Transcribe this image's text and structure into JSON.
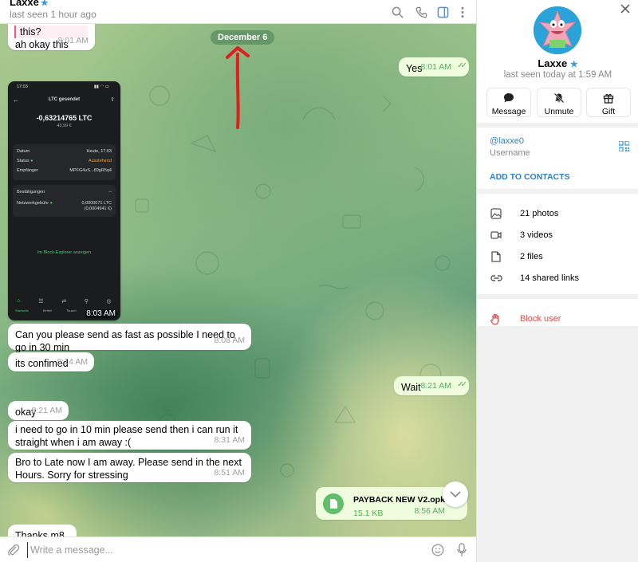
{
  "chat": {
    "name": "Laxxe",
    "status": "last seen 1 hour ago",
    "date_divider": "December 6",
    "input_placeholder": "Write a message...",
    "messages": [
      {
        "text": "this?",
        "time": ""
      },
      {
        "text": "ah okay this",
        "time": "8:01 AM"
      },
      {
        "text": "Yes",
        "time": "8:01 AM"
      },
      {
        "text": "Can you please send as fast as possible I need to go in 30 min",
        "time": "8:08 AM"
      },
      {
        "text": "its confimed",
        "time": "8:14 AM"
      },
      {
        "text": "Wait",
        "time": "8:21 AM"
      },
      {
        "text": "okay",
        "time": "8:21 AM"
      },
      {
        "text": "i need to go in 10 min please send then i can run it straight when i am away :(",
        "time": "8:31 AM"
      },
      {
        "text": "Bro to Late now I am away. Please send in the next Hours. Sorry for stressing",
        "time": "8:51 AM"
      },
      {
        "text": "Thanks m8",
        "time": ""
      }
    ],
    "photo_time": "8:03 AM",
    "file": {
      "name": "PAYBACK NEW V2.opk",
      "size": "15.1 KB",
      "time": "8:56 AM"
    }
  },
  "phone": {
    "clock": "17:03",
    "title": "LTC gesendet",
    "amount": "-0,63214765 LTC",
    "fiat": "43,99 €",
    "rows": [
      {
        "k": "Datum",
        "v": "Heute, 17:03"
      },
      {
        "k": "Status",
        "v": "Ausstehend"
      },
      {
        "k": "Empfänger",
        "v": "MPFG4uS...89gR5q4"
      }
    ],
    "rows2": [
      {
        "k": "Bestätigungen",
        "v": "--"
      },
      {
        "k": "Netzwerkgebühr",
        "v": "0,0000071 LTC"
      },
      {
        "k": "",
        "v": "(0,0004941 €)"
      }
    ],
    "explorer_link": "Im Block-Explorer anzeigen",
    "tabs": [
      "Startseite",
      "Befehl",
      "Tausch",
      "Trade",
      ""
    ]
  },
  "panel": {
    "name": "Laxxe",
    "status": "last seen today at 1:59 AM",
    "buttons": [
      "Message",
      "Unmute",
      "Gift"
    ],
    "username": "@laxxe0",
    "username_label": "Username",
    "add_contacts": "ADD TO CONTACTS",
    "media": [
      "21 photos",
      "3 videos",
      "2 files",
      "14 shared links"
    ],
    "block": "Block user"
  },
  "colors": {
    "accent": "#3a9ae0",
    "out_bubble": "#effdde",
    "danger": "#e04a4a",
    "annotation": "#e01e1e"
  }
}
